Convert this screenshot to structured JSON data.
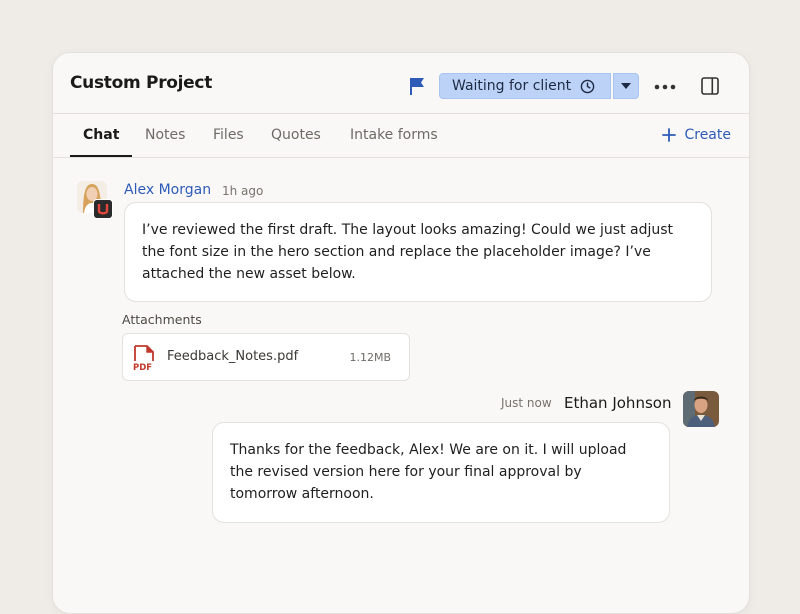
{
  "header": {
    "title": "Custom Project",
    "status_label": "Waiting for client",
    "icons": [
      "flag-icon",
      "clock-icon",
      "chevron-down-icon",
      "more-icon",
      "side-panel-icon"
    ]
  },
  "tabs": [
    {
      "label": "Chat",
      "active": true
    },
    {
      "label": "Notes",
      "active": false
    },
    {
      "label": "Files",
      "active": false
    },
    {
      "label": "Quotes",
      "active": false
    },
    {
      "label": "Intake forms",
      "active": false
    }
  ],
  "create_label": "Create",
  "messages": [
    {
      "author": "Alex Morgan",
      "time": "1h ago",
      "text": "I’ve reviewed the first draft. The layout looks amazing! Could we just adjust the font size in the hero section and replace the placeholder image? I’ve attached the new asset below.",
      "attachments_label": "Attachments",
      "attachment": {
        "name": "Feedback_Notes.pdf",
        "size": "1.12MB",
        "icon": "pdf-icon",
        "icon_text": "PDF"
      }
    },
    {
      "author": "Ethan Johnson",
      "time": "Just now",
      "text": "Thanks for the feedback, Alex! We are on it. I will upload the revised version here for your final approval by tomorrow afternoon."
    }
  ],
  "colors": {
    "accent": "#2e5bb8",
    "status_bg": "#bcd3f7",
    "pdf_red": "#c0392b",
    "flag_blue": "#2e5bb8"
  }
}
